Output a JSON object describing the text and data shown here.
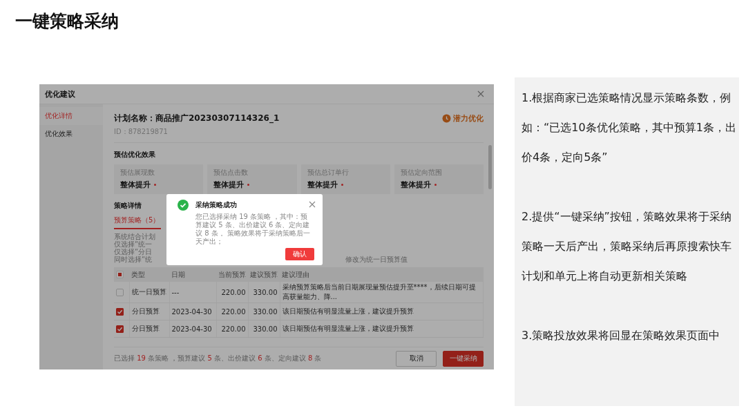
{
  "slide_title": "一键策略采纳",
  "dialog": {
    "title": "优化建议",
    "sidebar": [
      {
        "label": "优化详情",
        "selected": true
      },
      {
        "label": "优化效果",
        "selected": false
      }
    ],
    "plan_name": "计划名称：商品推广20230307114326_1",
    "plan_id": "ID：878219871",
    "badge": "潜力优化",
    "effect_heading": "预估优化效果",
    "estimates": [
      {
        "label": "预估展现数",
        "value": "整体提升"
      },
      {
        "label": "预估点击数",
        "value": "整体提升"
      },
      {
        "label": "预估总订单行",
        "value": "整体提升"
      },
      {
        "label": "预估定向范围",
        "value": "整体提升"
      }
    ],
    "details_heading": "策略详情",
    "tabs": [
      {
        "label": "预算策略（5）",
        "selected": true
      }
    ],
    "notes": [
      "系统结合计划",
      "仅选择“统一",
      "仅选择“分日",
      "同时选择“统"
    ],
    "note_tail": "修改为统一日预算值",
    "table": {
      "select_all_indeterminate": true,
      "columns": [
        "类型",
        "日期",
        "当前预算",
        "建议预算",
        "建议理由"
      ],
      "rows": [
        {
          "checked": false,
          "cells": [
            "统一日预算",
            "---",
            "220.00",
            "330.00",
            "采纳预算策略后当前日期展现量预估提升至****，后续日期可提高获量能力、降..."
          ]
        },
        {
          "checked": true,
          "cells": [
            "分日预算",
            "2023-04-30",
            "220.00",
            "330.00",
            "该日期预估有明显流量上涨，建议提升预算"
          ]
        },
        {
          "checked": true,
          "cells": [
            "分日预算",
            "2023-04-30",
            "220.00",
            "330.00",
            "该日期预估有明显流量上涨，建议提升预算"
          ]
        }
      ]
    },
    "summary": "已选择 **19** 条策略 ，预算建议 **5** 条、出价建议 **6** 条、定向建议 **8** 条",
    "buttons": [
      {
        "label": "取消",
        "kind": "secondary"
      },
      {
        "label": "一键采纳",
        "kind": "primary"
      }
    ]
  },
  "modal": {
    "title": "采纳策略成功",
    "message": "您已选择采纳 19 条策略 ，其中：预算建议 5 条、出价建议 6 条、定向建议 8 条 。策略效果将于采纳策略后一天产出；",
    "button": "确认"
  },
  "notes_panel": [
    "1.根据商家已选策略情况显示策略条数，例如：“已选10条优化策略，其中预算1条，出价4条，定向5条”",
    "2.提供“一键采纳”按钮，策略效果将于采纳策略一天后产出，策略采纳后再原搜索快车计划和单元上将自动更新相关策略",
    "3.策略投放效果将回显在策略效果页面中"
  ]
}
